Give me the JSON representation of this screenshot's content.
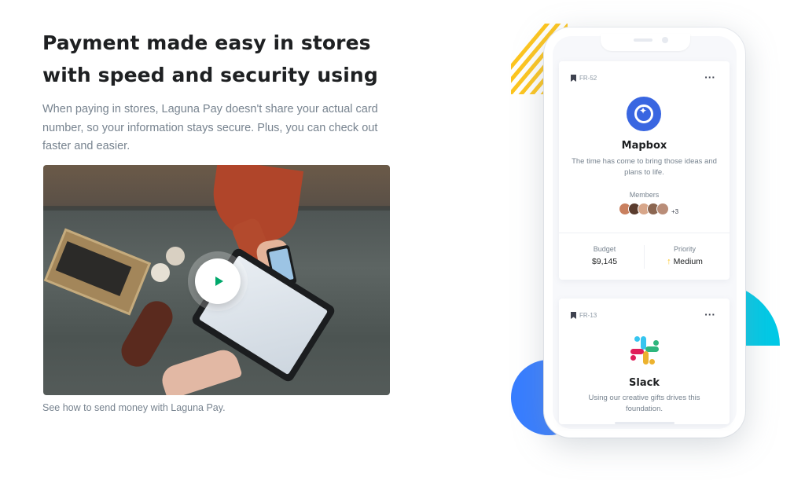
{
  "hero": {
    "headline": "Payment made easy in stores with speed and security using",
    "lead": "When paying in stores, Laguna Pay doesn't share your actual card number, so your information stays secure. Plus, you can check out faster and easier.",
    "caption": "See how to send money with Laguna Pay."
  },
  "video": {
    "play_icon": "play-icon"
  },
  "cards": [
    {
      "tag": "FR-52",
      "name": "Mapbox",
      "description": "The time has come to bring those ideas and plans to life.",
      "members_label": "Members",
      "members_more": "+3",
      "budget_label": "Budget",
      "budget_value": "$9,145",
      "priority_label": "Priority",
      "priority_value": "Medium",
      "more_menu": "···"
    },
    {
      "tag": "FR-13",
      "name": "Slack",
      "description": "Using our creative gifts drives this foundation.",
      "more_menu": "···"
    }
  ],
  "colors": {
    "accent_blue": "#377dff",
    "accent_yellow": "#fdc51e",
    "accent_cyan": "#00c9e6",
    "play_green": "#00a86b",
    "mapbox_blue": "#3966e1"
  }
}
